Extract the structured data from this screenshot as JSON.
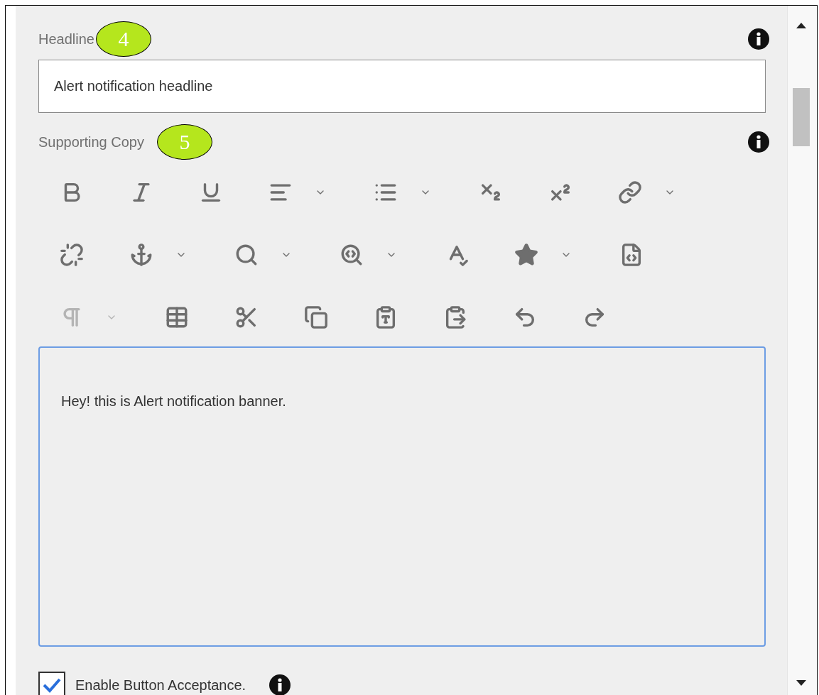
{
  "headline": {
    "label": "Headline",
    "callout": "4",
    "value": "Alert notification headline"
  },
  "supporting_copy": {
    "label": "Supporting Copy",
    "callout": "5"
  },
  "toolbar_rows": [
    [
      {
        "kind": "bold",
        "dropdown": false,
        "disabled": false
      },
      {
        "kind": "italic",
        "dropdown": false,
        "disabled": false
      },
      {
        "kind": "underline",
        "dropdown": false,
        "disabled": false
      },
      {
        "kind": "align",
        "dropdown": true,
        "disabled": false
      },
      {
        "kind": "list",
        "dropdown": true,
        "disabled": false
      },
      {
        "kind": "subscript",
        "dropdown": false,
        "disabled": false
      },
      {
        "kind": "superscript",
        "dropdown": false,
        "disabled": false
      },
      {
        "kind": "link",
        "dropdown": true,
        "disabled": false
      }
    ],
    [
      {
        "kind": "unlink",
        "dropdown": false,
        "disabled": false
      },
      {
        "kind": "anchor",
        "dropdown": true,
        "disabled": false
      },
      {
        "kind": "find",
        "dropdown": true,
        "disabled": false
      },
      {
        "kind": "replace",
        "dropdown": true,
        "disabled": false
      },
      {
        "kind": "spellcheck",
        "dropdown": false,
        "disabled": false
      },
      {
        "kind": "star",
        "dropdown": true,
        "disabled": false
      },
      {
        "kind": "source",
        "dropdown": false,
        "disabled": false
      }
    ],
    [
      {
        "kind": "paragraph",
        "dropdown": true,
        "disabled": true
      },
      {
        "kind": "table",
        "dropdown": false,
        "disabled": false
      },
      {
        "kind": "cut",
        "dropdown": false,
        "disabled": false
      },
      {
        "kind": "copy",
        "dropdown": false,
        "disabled": false
      },
      {
        "kind": "paste_text",
        "dropdown": false,
        "disabled": false
      },
      {
        "kind": "paste_code",
        "dropdown": false,
        "disabled": false
      },
      {
        "kind": "undo",
        "dropdown": false,
        "disabled": false
      },
      {
        "kind": "redo",
        "dropdown": false,
        "disabled": false
      }
    ]
  ],
  "editor": {
    "value": "Hey! this is Alert notification banner."
  },
  "checkbox": {
    "label": "Enable Button Acceptance.",
    "checked": true
  }
}
